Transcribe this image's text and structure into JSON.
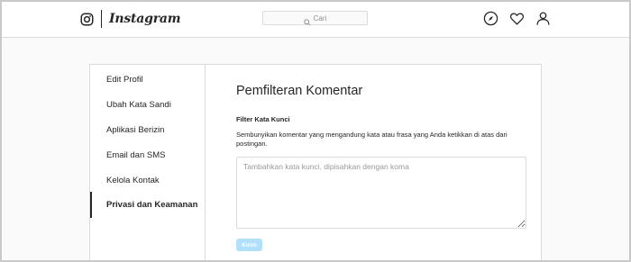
{
  "topbar": {
    "brand": "Instagram",
    "search_placeholder": "Cari",
    "icons": [
      "camera-icon",
      "search-icon",
      "compass-icon",
      "heart-icon",
      "person-icon"
    ]
  },
  "sidebar": {
    "items": [
      {
        "label": "Edit Profil",
        "active": false
      },
      {
        "label": "Ubah Kata Sandi",
        "active": false
      },
      {
        "label": "Aplikasi Berizin",
        "active": false
      },
      {
        "label": "Email dan SMS",
        "active": false
      },
      {
        "label": "Kelola Kontak",
        "active": false
      },
      {
        "label": "Privasi dan Keamanan",
        "active": true
      }
    ]
  },
  "main": {
    "title": "Pemfilteran Komentar",
    "section_title": "Filter Kata Kunci",
    "description": "Sembunyikan komentar yang mengandung kata atau frasa yang Anda ketikkan di atas dari postingan.",
    "keywords_placeholder": "Tambahkan kata kunci, dipisahkan dengan koma",
    "keywords_value": "",
    "submit_label": "Kirim"
  },
  "colors": {
    "page_bg": "#fafafa",
    "border": "#dbdbdb",
    "text": "#262626",
    "muted": "#8e8e8e",
    "button_disabled": "#b2dffc"
  }
}
